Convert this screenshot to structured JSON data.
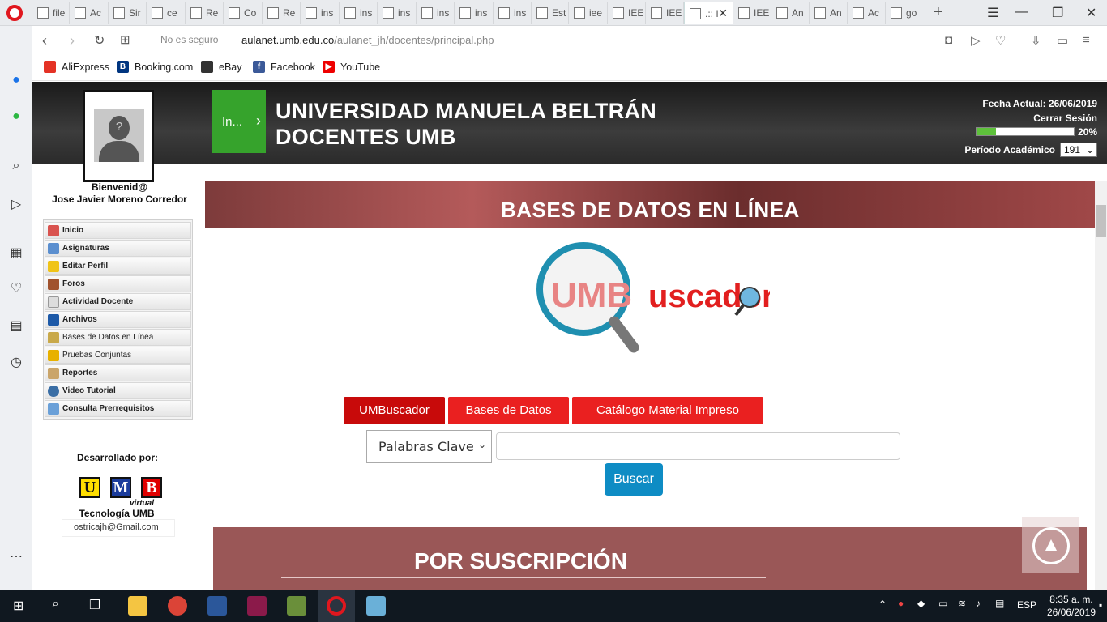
{
  "browser": {
    "tabs": [
      "file",
      "Ac",
      "Sir",
      "ce",
      "Re",
      "Co",
      "Re",
      "ins",
      "ins",
      "ins",
      "ins",
      "ins",
      "ins",
      "Est",
      "iee",
      "IEE",
      "IEE",
      ".:: I",
      "IEE",
      "An",
      "An",
      "Ac",
      "go"
    ],
    "address": {
      "security": "No es seguro",
      "host": "aulanet.umb.edu.co",
      "path": "/aulanet_jh/docentes/principal.php"
    },
    "bookmarks": [
      "AliExpress",
      "Booking.com",
      "eBay",
      "Facebook",
      "YouTube"
    ]
  },
  "header": {
    "green_button": "In...",
    "title_line1": "UNIVERSIDAD MANUELA BELTRÁN",
    "title_line2": "DOCENTES UMB",
    "fecha": "Fecha Actual: 26/06/2019",
    "cerrar": "Cerrar Sesión",
    "progress_pct": "20%",
    "progress_value": 0.2,
    "periodo_label": "Período Académico",
    "periodo_value": "191"
  },
  "user": {
    "welcome": "Bienvenid@",
    "name": "Jose Javier Moreno Corredor"
  },
  "menu": [
    "Inicio",
    "Asignaturas",
    "Editar Perfil",
    "Foros",
    "Actividad Docente",
    "Archivos",
    "Bases de Datos en Línea",
    "Pruebas Conjuntas",
    "Reportes",
    "Video Tutorial",
    "Consulta Prerrequisitos"
  ],
  "footer_left": {
    "dev": "Desarrollado por:",
    "virtual": "virtual",
    "tec": "Tecnología UMB",
    "email": "ostricajh@Gmail.com",
    "letters": [
      "U",
      "M",
      "B"
    ]
  },
  "content": {
    "banner": "BASES DE DATOS EN LÍNEA",
    "logo_text_a": "UMB",
    "logo_text_b": "uscador",
    "tabs": [
      "UMBuscador",
      "Bases de Datos",
      "Catálogo Material Impreso"
    ],
    "select_value": "Palabras Clave",
    "search_value": "",
    "search_button": "Buscar",
    "subscription": "POR SUSCRIPCIÓN"
  },
  "taskbar": {
    "lang": "ESP",
    "time": "8:35 a. m.",
    "date": "26/06/2019"
  },
  "colors": {
    "accent_red": "#d10000",
    "tab_red": "#e81c1c",
    "button_blue": "#0e8cc4",
    "green": "#36a32c"
  }
}
